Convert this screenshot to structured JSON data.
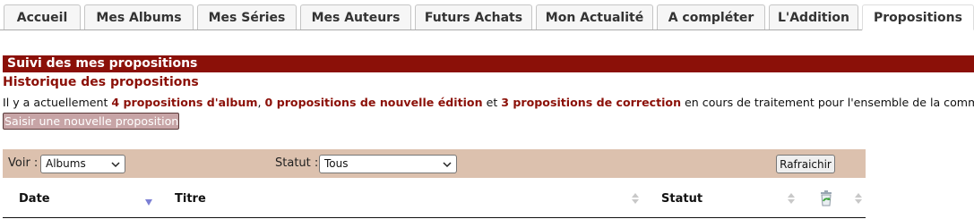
{
  "tabs": [
    {
      "label": "Accueil"
    },
    {
      "label": "Mes Albums"
    },
    {
      "label": "Mes Séries"
    },
    {
      "label": "Mes Auteurs"
    },
    {
      "label": "Futurs Achats"
    },
    {
      "label": "Mon Actualité"
    },
    {
      "label": "A compléter"
    },
    {
      "label": "L'Addition"
    },
    {
      "label": "Propositions"
    }
  ],
  "active_tab": "Propositions",
  "section": {
    "title": "Suivi des mes propositions",
    "subtitle": "Historique des propositions"
  },
  "summary": {
    "prefix": "Il y a actuellement ",
    "albums": "4 propositions d'album",
    "sep1": ", ",
    "editions": "0 propositions de nouvelle édition",
    "sep2": " et ",
    "corrections": "3 propositions de correction",
    "suffix": " en cours de traitement pour l'ensemble de la commun"
  },
  "new_button": "Saisir une nouvelle proposition",
  "filters": {
    "voir_label": "Voir :",
    "voir_value": "Albums",
    "statut_label": "Statut :",
    "statut_value": "Tous",
    "refresh_label": "Rafraichir"
  },
  "table": {
    "columns": [
      "Date",
      "Titre",
      "Statut"
    ]
  },
  "colors": {
    "accent": "#8b1008",
    "filter_bg": "#dcc1ae",
    "button_bg": "#c7a4a6"
  }
}
